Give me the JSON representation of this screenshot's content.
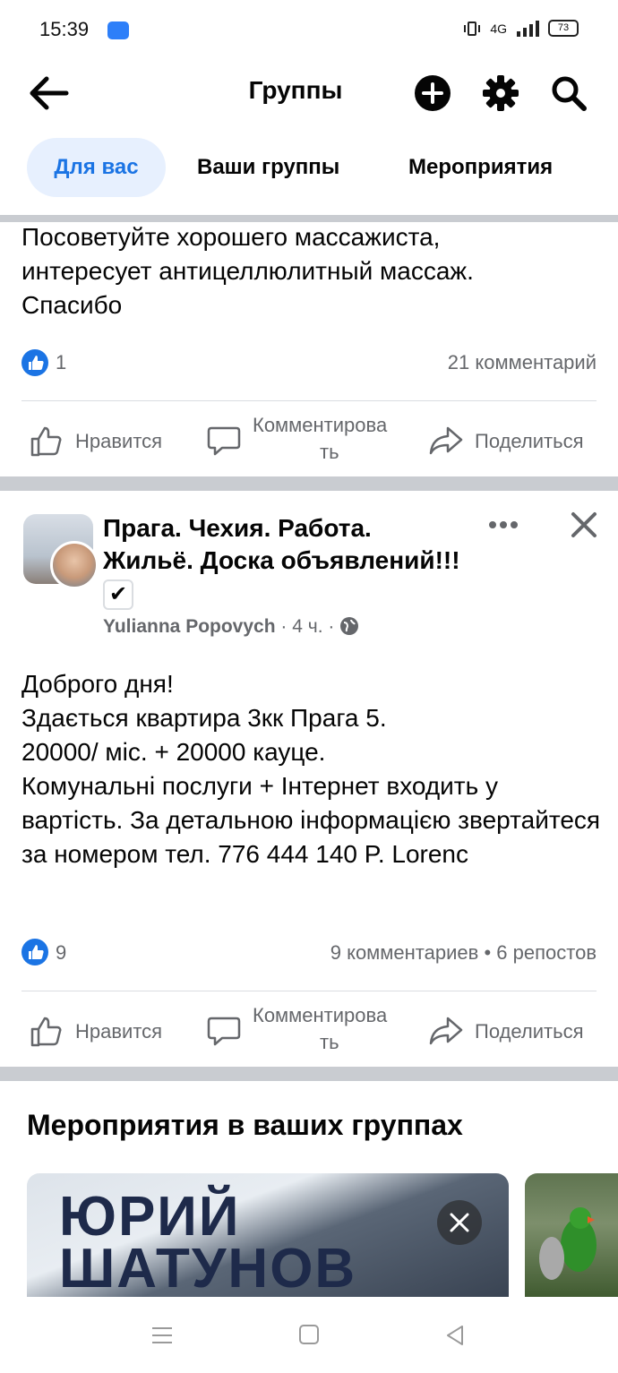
{
  "status": {
    "time": "15:39",
    "network": "4G",
    "battery": "73"
  },
  "header": {
    "title": "Группы"
  },
  "tabs": [
    {
      "label": "Для вас",
      "active": true
    },
    {
      "label": "Ваши группы",
      "active": false
    },
    {
      "label": "Мероприятия",
      "active": false
    }
  ],
  "post1": {
    "text": "Посоветуйте хорошего массажиста,\nинтересует антицеллюлитный массаж.\nСпасибо",
    "likes": "1",
    "comments": "21 комментарий"
  },
  "actions": {
    "like": "Нравится",
    "comment_line1": "Комментирова",
    "comment_line2": "ть",
    "share": "Поделиться"
  },
  "post2": {
    "group_name": "Прага. Чехия. Работа. Жильё. Доска объявлений!!!",
    "author": "Yulianna Popovych",
    "time": "4 ч.",
    "text": "Доброго дня!\nЗдається квартира 3кк Прага 5.\n20000/ міс. + 20000 кауце.\nКомунальні послуги + Інтернет входить у вартість. За детальною інформацією звертайтеся за номером тел. 776 444 140 P. Lorenc",
    "likes": "9",
    "comments": "9 комментариев",
    "shares": "6 репостов"
  },
  "events": {
    "title": "Мероприятия в ваших группах",
    "card_text_line1": "ЮРИЙ",
    "card_text_line2": "ШАТУНОВ"
  },
  "colors": {
    "accent": "#1b74e4",
    "tab_active_bg": "#e7f0fe",
    "muted": "#65676b",
    "divider": "#c9ccd1"
  }
}
